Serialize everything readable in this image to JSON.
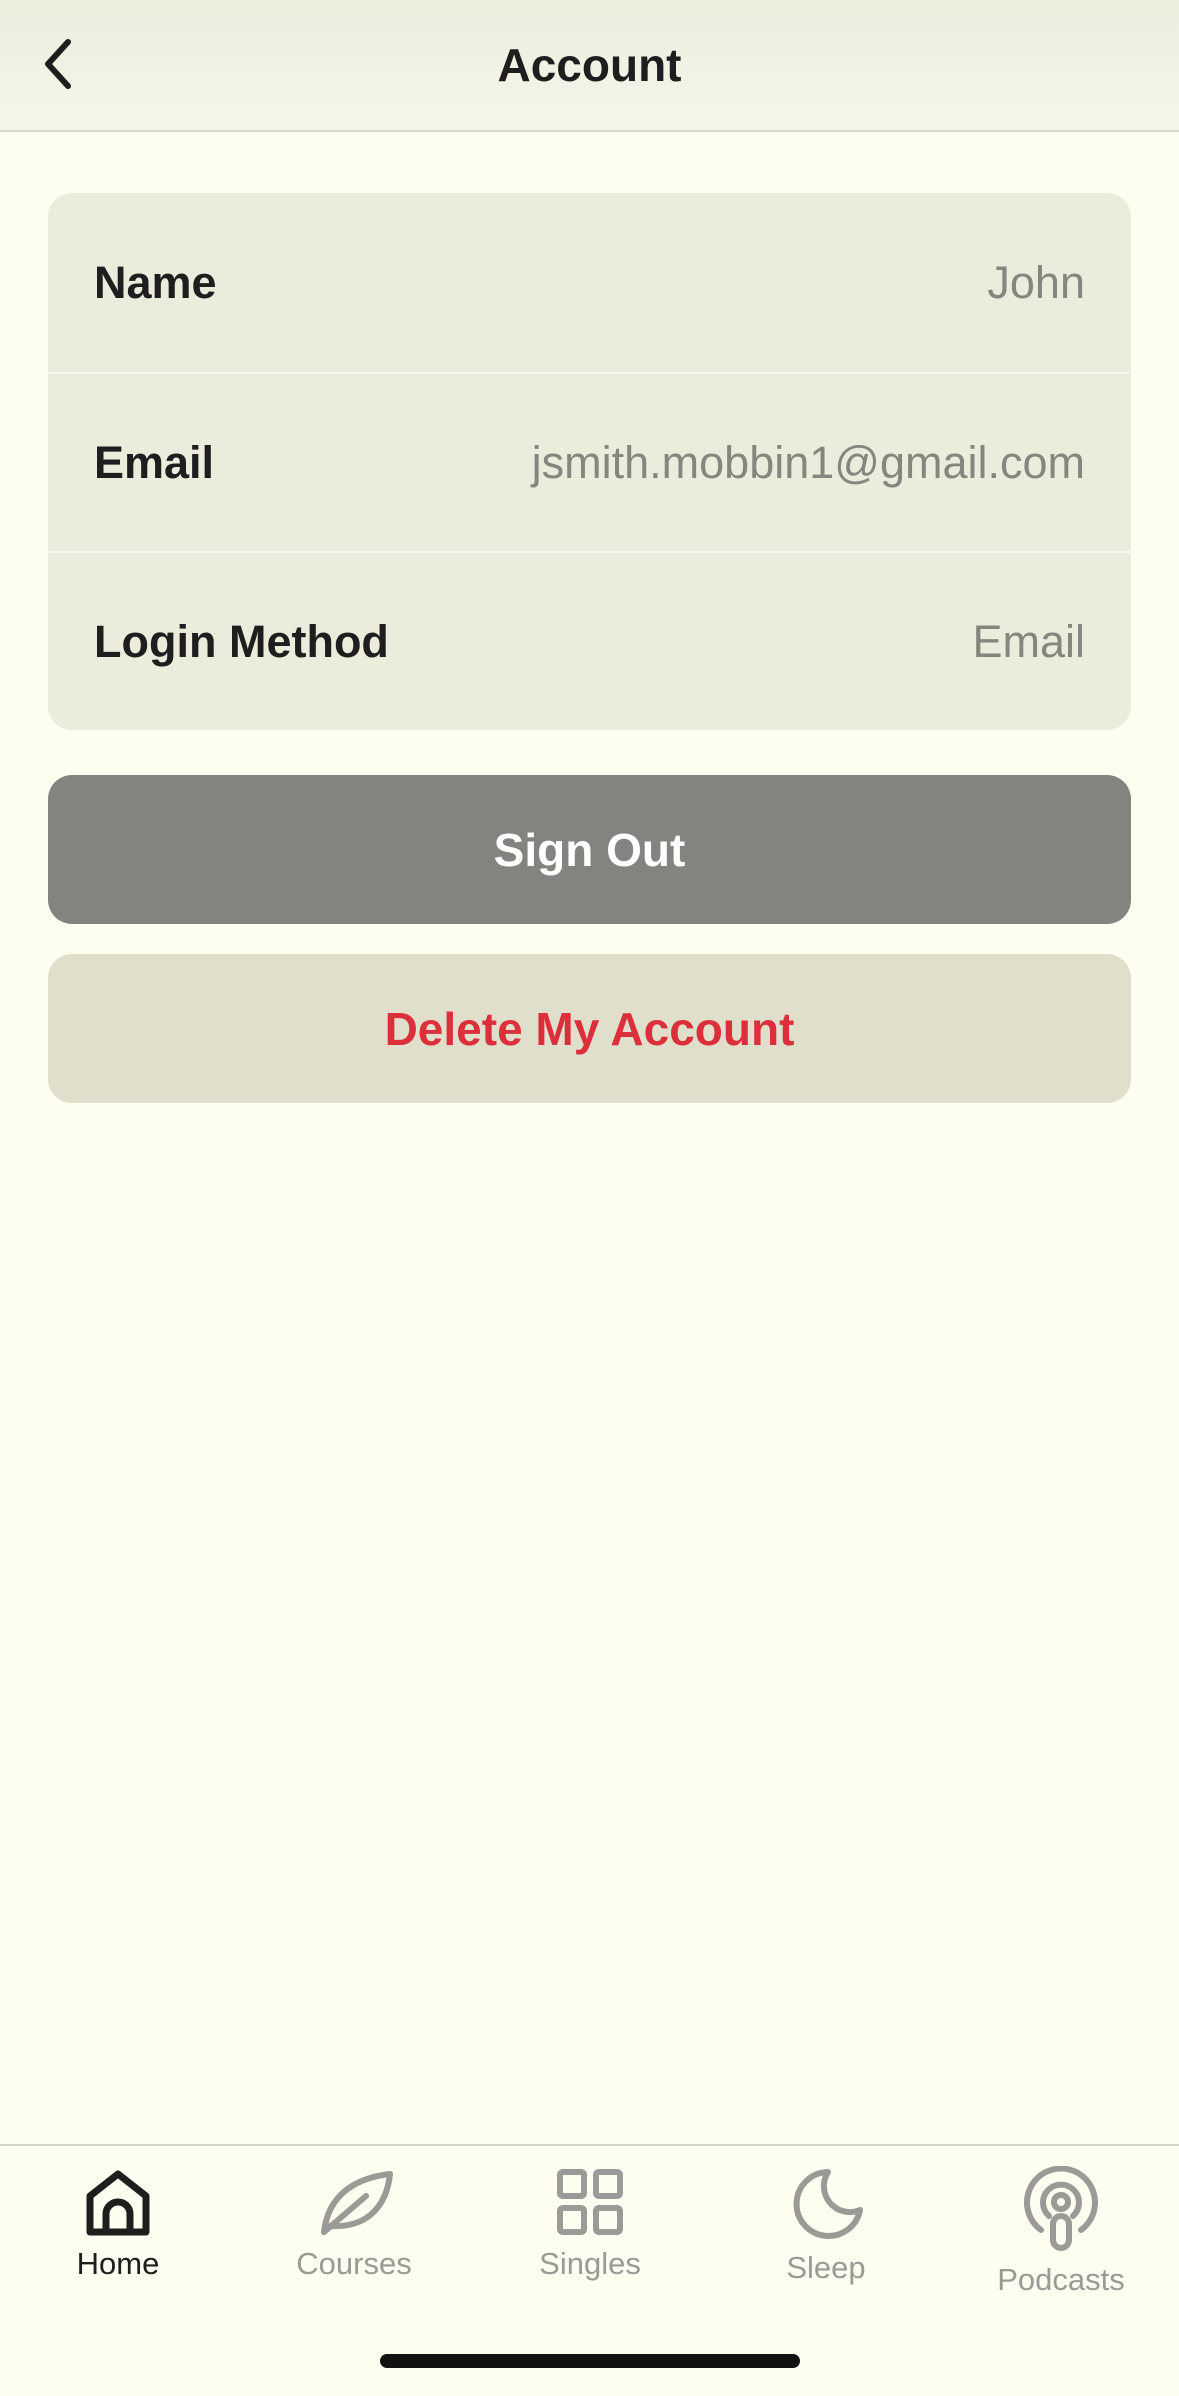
{
  "header": {
    "title": "Account",
    "back_icon": "chevron-left-icon"
  },
  "account": {
    "rows": [
      {
        "label": "Name",
        "value": "John"
      },
      {
        "label": "Email",
        "value": "jsmith.mobbin1@gmail.com"
      },
      {
        "label": "Login Method",
        "value": "Email"
      }
    ]
  },
  "actions": {
    "sign_out_label": "Sign Out",
    "delete_label": "Delete My Account"
  },
  "tabbar": {
    "active": "Home",
    "items": [
      {
        "label": "Home",
        "icon": "home-icon"
      },
      {
        "label": "Courses",
        "icon": "leaf-icon"
      },
      {
        "label": "Singles",
        "icon": "grid-icon"
      },
      {
        "label": "Sleep",
        "icon": "moon-icon"
      },
      {
        "label": "Podcasts",
        "icon": "podcast-icon"
      }
    ]
  },
  "colors": {
    "background": "#fdfdf0",
    "card": "#ececdc",
    "sign_out_bg": "#838380",
    "delete_bg": "#dfdfcb",
    "delete_text": "#dc2f3b",
    "inactive_tab": "#9a9a96"
  }
}
